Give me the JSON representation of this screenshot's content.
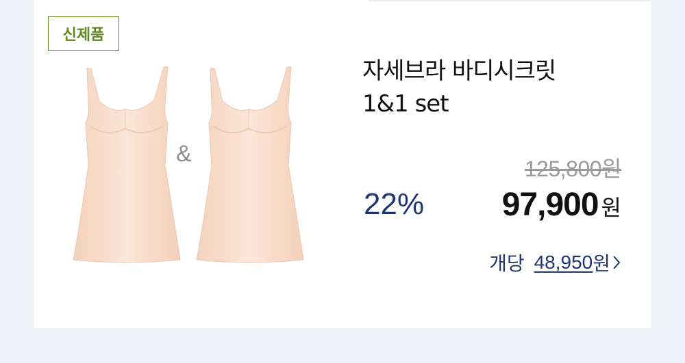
{
  "badge": "신제품",
  "separator": "&",
  "product": {
    "title_line1": "자세브라 바디시크릿",
    "title_line2": "1&1 set"
  },
  "pricing": {
    "original": "125,800",
    "original_currency": "원",
    "discount": "22%",
    "sale": "97,900",
    "sale_currency": "원",
    "unit_label": "개당",
    "unit_price": "48,950",
    "unit_currency": "원"
  },
  "colors": {
    "background": "#eff3f8",
    "badge_green": "#5d8a1f",
    "accent_navy": "#1f3470",
    "garment_skin": "#f8dfcd"
  },
  "icons": [
    "chevron-right-icon"
  ]
}
